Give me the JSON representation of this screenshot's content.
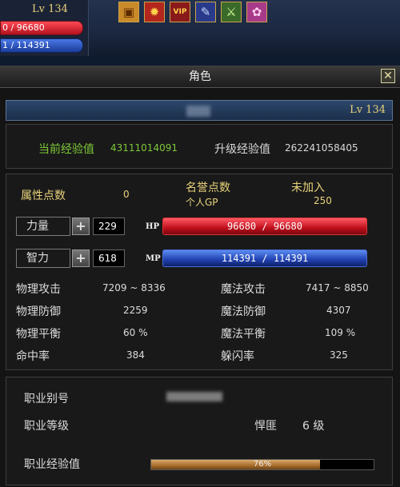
{
  "hud": {
    "level": "Lv 134",
    "hp_text": "0 / 96680",
    "mp_text": "1 / 114391",
    "buffs": [
      {
        "icon": "treasure-chest-icon",
        "glyph": "▣",
        "bg": "#c98a2a",
        "fg": "#5a2a00"
      },
      {
        "icon": "flame-icon",
        "glyph": "✹",
        "bg": "#b3261e",
        "fg": "#ffd24a"
      },
      {
        "icon": "vip-badge-icon",
        "glyph": "VIP",
        "bg": "#8a1a1a",
        "fg": "#ffd24a"
      },
      {
        "icon": "scroll-icon",
        "glyph": "✎",
        "bg": "#2a3a8a",
        "fg": "#c8d8ff"
      },
      {
        "icon": "sword-icon",
        "glyph": "⚔",
        "bg": "#3a6a2a",
        "fg": "#d8ff9a"
      },
      {
        "icon": "flower-icon",
        "glyph": "✿",
        "bg": "#a83a8a",
        "fg": "#ffd0f0"
      }
    ]
  },
  "window": {
    "title": "角色",
    "close_glyph": "✕",
    "level": "Lv 134"
  },
  "exp": {
    "current_label": "当前经验值",
    "current_value": "43111014091",
    "next_label": "升级经验值",
    "next_value": "262241058405"
  },
  "attributes": {
    "points_label": "属性点数",
    "points_value": "0",
    "honor_label": "名誉点数",
    "honor_value": "未加入",
    "gp_label": "个人GP",
    "gp_value": "250",
    "strength_label": "力量",
    "strength_value": "229",
    "intel_label": "智力",
    "intel_value": "618",
    "hp_label": "HP",
    "hp_text": "96680 / 96680",
    "mp_label": "MP",
    "mp_text": "114391 / 114391",
    "stats": [
      {
        "label": "物理攻击",
        "value": "7209 ~ 8336"
      },
      {
        "label": "物理防御",
        "value": "2259"
      },
      {
        "label": "物理平衡",
        "value": "60 %"
      },
      {
        "label": "命中率",
        "value": "384"
      }
    ],
    "magic_stats": [
      {
        "label": "魔法攻击",
        "value": "7417 ~ 8850"
      },
      {
        "label": "魔法防御",
        "value": "4307"
      },
      {
        "label": "魔法平衡",
        "value": "109 %"
      },
      {
        "label": "躲闪率",
        "value": "325"
      }
    ]
  },
  "job": {
    "alias_label": "职业别号",
    "level_label": "职业等级",
    "class_name": "悍匪",
    "class_level": "6 级",
    "exp_label": "职业经验值",
    "exp_percent_text": "76%",
    "exp_fraction": 0.76
  }
}
